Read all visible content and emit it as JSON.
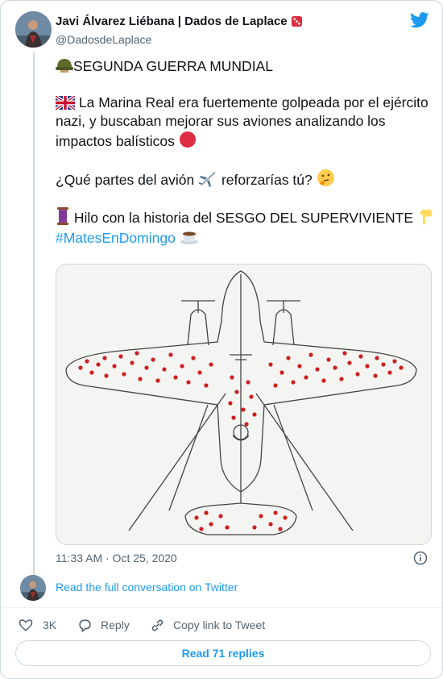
{
  "author": {
    "name": "Javi Álvarez Liébana | Dados de Laplace",
    "handle": "@DadosdeLaplace"
  },
  "tweet": {
    "line1": "SEGUNDA GUERRA MUNDIAL",
    "para2": "La Marina Real era fuertemente golpeada por el ejército nazi, y buscaban mejorar sus aviones analizando los impactos balísticos",
    "para3_before": "¿Qué partes del avión",
    "para3_after": "reforzarías tú?",
    "para4_before": "Hilo con la historia del SESGO DEL SUPERVIVIENTE",
    "hashtag": "#MatesEnDomingo",
    "image_alt": "Diagrama de avión con impactos de bala"
  },
  "meta": {
    "timestamp": "11:33 AM · Oct 25, 2020"
  },
  "links": {
    "read_conversation": "Read the full conversation on Twitter"
  },
  "actions": {
    "likes": "3K",
    "reply": "Reply",
    "copy_link": "Copy link to Tweet",
    "read_replies": "Read 71 replies"
  },
  "colors": {
    "accent": "#1d9bf0",
    "bullet_red": "#cc2020",
    "muted": "#536471"
  },
  "icons": [
    "twitter-bird-icon",
    "helmet-emoji",
    "uk-flag-emoji",
    "red-circle-emoji",
    "airplane-emoji",
    "thinking-emoji",
    "thread-emoji",
    "pointing-down-emoji",
    "coffee-emoji",
    "info-icon",
    "heart-icon",
    "reply-icon",
    "link-icon"
  ]
}
